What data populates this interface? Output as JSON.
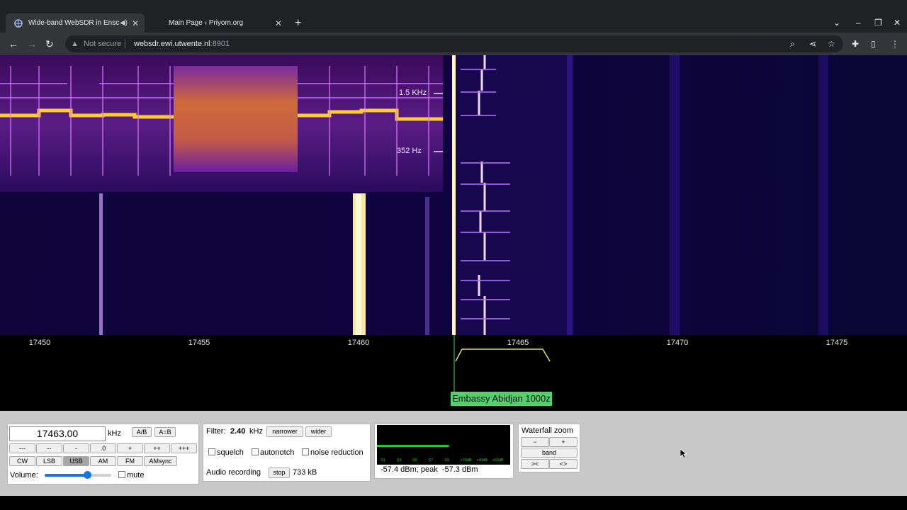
{
  "browser": {
    "tabs": [
      {
        "title": "Wide-band WebSDR in Ensch",
        "active": true
      },
      {
        "title": "Main Page › Priyom.org",
        "active": false
      }
    ],
    "address": {
      "security_label": "Not secure",
      "host": "websdr.ewi.utwente.nl",
      "port": ":8901"
    }
  },
  "waterfall": {
    "freq_ticks": [
      "17450",
      "17455",
      "17460",
      "17465",
      "17470",
      "17475"
    ],
    "inset_labels": {
      "upper": "1.5 KHz",
      "lower": "352 Hz"
    },
    "station_label": "Embassy Abidjan 1000z"
  },
  "tuning": {
    "frequency": "17463.00",
    "unit": "kHz",
    "ab_label": "A/B",
    "aeqb_label": "A=B",
    "step_buttons": [
      "---",
      "--",
      "-",
      ".0",
      "+",
      "++",
      "+++"
    ],
    "modes": [
      "CW",
      "LSB",
      "USB",
      "AM",
      "FM",
      "AMsync"
    ],
    "selected_mode": "USB",
    "volume_label": "Volume:",
    "volume_level_percent": 64,
    "mute_label": "mute"
  },
  "filter": {
    "label": "Filter:",
    "width": "2.40",
    "unit": "kHz",
    "narrower_label": "narrower",
    "wider_label": "wider",
    "options": [
      "squelch",
      "autonotch",
      "noise reduction"
    ],
    "recording_label": "Audio recording",
    "stop_label": "stop",
    "recording_size": "733 kB"
  },
  "smeter": {
    "scale": [
      "S1",
      "S3",
      "S5",
      "S7",
      "S9",
      "+20dB",
      "+40dB",
      "+60dB"
    ],
    "level_fraction": 0.54,
    "reading": "-57.4 dBm; peak  -57.3 dBm"
  },
  "zoom": {
    "title": "Waterfall zoom",
    "minus": "−",
    "plus": "+",
    "band": "band",
    "narrow": "><",
    "wide": "<>"
  },
  "colors": {
    "chrome_dark": "#202124",
    "chrome_toolbar": "#35363a",
    "waterfall_bg": "#0c0333",
    "station_green": "#53d16b",
    "smeter_bar": "#22c52e"
  }
}
